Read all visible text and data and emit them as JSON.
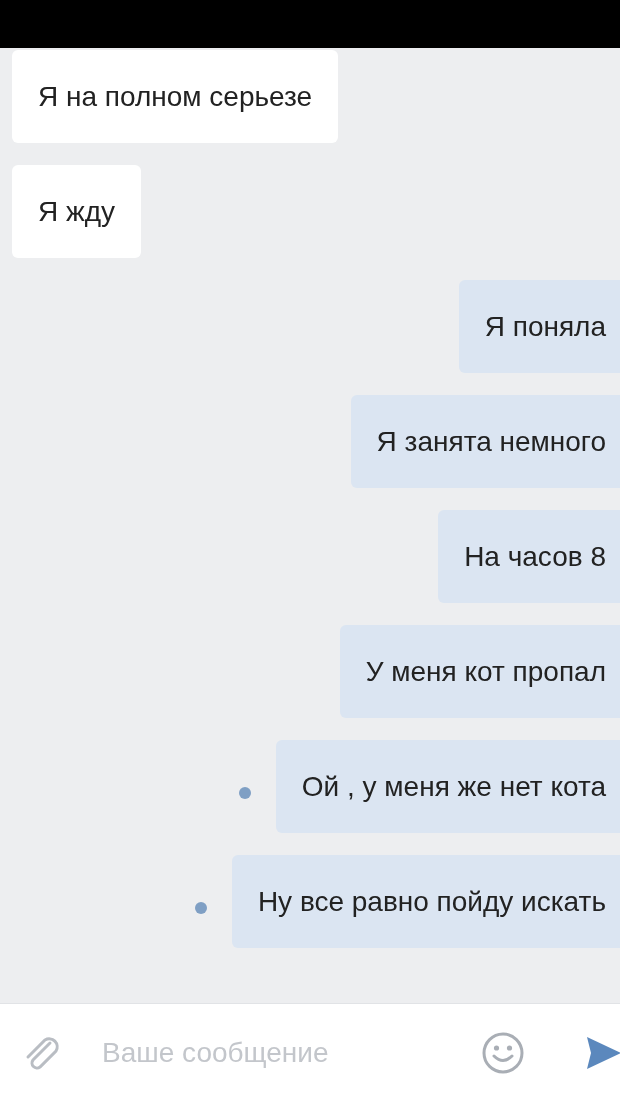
{
  "messages": [
    {
      "kind": "incoming",
      "text": "Я на полном серьезе",
      "unread": false
    },
    {
      "kind": "incoming",
      "text": "Я жду",
      "unread": false
    },
    {
      "kind": "outgoing",
      "text": "Я поняла",
      "unread": false
    },
    {
      "kind": "outgoing",
      "text": "Я занята немного",
      "unread": false
    },
    {
      "kind": "outgoing",
      "text": "На часов 8",
      "unread": false
    },
    {
      "kind": "outgoing",
      "text": "У меня кот пропал",
      "unread": false
    },
    {
      "kind": "outgoing",
      "text": "Ой , у меня же нет кота",
      "unread": true
    },
    {
      "kind": "outgoing",
      "text": "Ну все равно пойду искать",
      "unread": true
    }
  ],
  "composer": {
    "placeholder": "Ваше сообщение"
  }
}
